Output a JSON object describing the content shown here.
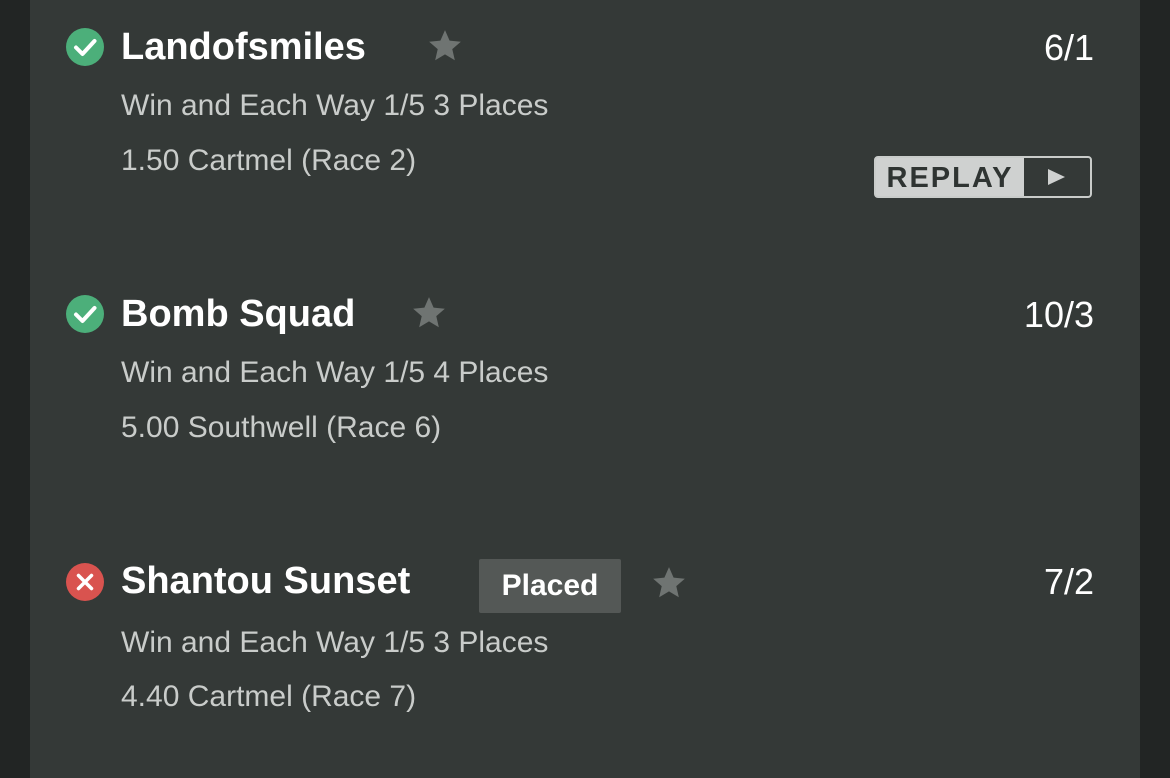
{
  "colors": {
    "win_green": "#4caf7a",
    "loss_red": "#d9534f",
    "star_gray": "#6f7472",
    "panel_bg": "#343937"
  },
  "bets": [
    {
      "status": "won",
      "status_icon": "check-circle-icon",
      "name": "Landofsmiles",
      "odds": "6/1",
      "bet_type": "Win and Each Way 1/5 3 Places",
      "race": "1.50 Cartmel (Race 2)",
      "replay_label": "REPLAY"
    },
    {
      "status": "won",
      "status_icon": "check-circle-icon",
      "name": "Bomb Squad",
      "odds": "10/3",
      "bet_type": "Win and Each Way 1/5 4 Places",
      "race": "5.00 Southwell (Race 6)"
    },
    {
      "status": "lost",
      "status_icon": "x-circle-icon",
      "name": "Shantou Sunset",
      "badge": "Placed",
      "odds": "7/2",
      "bet_type": "Win and Each Way 1/5 3 Places",
      "race": "4.40 Cartmel (Race 7)"
    }
  ]
}
